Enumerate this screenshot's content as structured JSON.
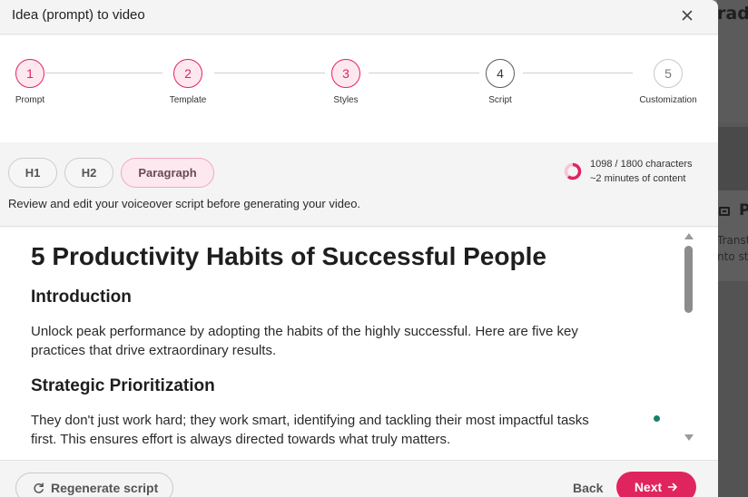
{
  "background": {
    "title": "rade",
    "section_label": "P",
    "line1": "Transt",
    "line2": "nto st"
  },
  "modal": {
    "title": "Idea (prompt) to video",
    "close_icon": "close-icon"
  },
  "stepper": {
    "steps": [
      {
        "number": "1",
        "label": "Prompt",
        "state": "complete"
      },
      {
        "number": "2",
        "label": "Template",
        "state": "complete"
      },
      {
        "number": "3",
        "label": "Styles",
        "state": "complete"
      },
      {
        "number": "4",
        "label": "Script",
        "state": "current"
      },
      {
        "number": "5",
        "label": "Customization",
        "state": "future"
      }
    ]
  },
  "toolbar": {
    "formats": [
      {
        "label": "H1",
        "active": false
      },
      {
        "label": "H2",
        "active": false
      },
      {
        "label": "Paragraph",
        "active": true
      }
    ],
    "char_count": "1098 / 1800 characters",
    "char_fraction": 0.61,
    "duration": "~2 minutes of content",
    "review_text": "Review and edit your voiceover script before generating your video."
  },
  "editor": {
    "title": "5 Productivity Habits of Successful People",
    "sections": [
      {
        "heading": "Introduction",
        "lines": [
          "Unlock peak performance by adopting the habits of the highly successful. Here are five key",
          "practices that drive extraordinary results."
        ]
      },
      {
        "heading": "Strategic Prioritization",
        "lines": [
          "They don't just work hard; they work smart, identifying and tackling their most impactful tasks",
          "first. This ensures effort is always directed towards what truly matters."
        ]
      }
    ]
  },
  "footer": {
    "regenerate_label": "Regenerate script",
    "back_label": "Back",
    "next_label": "Next"
  },
  "colors": {
    "accent": "#e0245e",
    "accent_light": "#fde8ef"
  }
}
